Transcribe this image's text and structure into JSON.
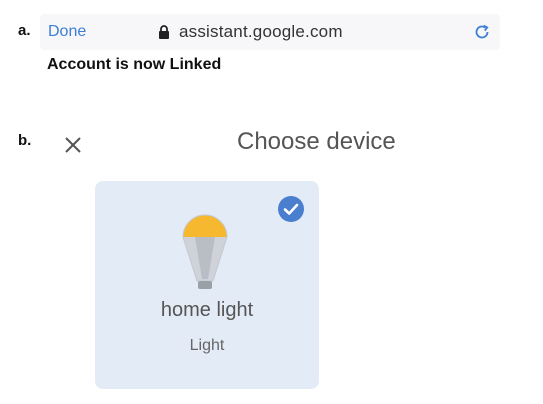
{
  "section_a": {
    "label": "a.",
    "browser_bar": {
      "done_label": "Done",
      "url": "assistant.google.com",
      "reload_icon": "reload-icon",
      "lock_icon": "lock-icon"
    },
    "status_message": "Account is now Linked"
  },
  "section_b": {
    "label": "b.",
    "close_icon": "close-icon",
    "title": "Choose device",
    "devices": [
      {
        "name": "home light",
        "type": "Light",
        "selected": true,
        "icon": "light-bulb-icon"
      }
    ]
  },
  "colors": {
    "done_link": "#3d7fd6",
    "card_background": "#e3ebf7",
    "check_badge": "#4a7fd0",
    "bulb_glow": "#f5b82e"
  }
}
